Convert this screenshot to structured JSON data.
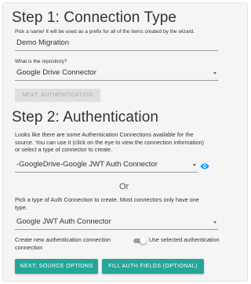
{
  "step1": {
    "title": "Step 1: Connection Type",
    "name_hint": "Pick a name! It will be used as a prefix for all of the items created by the wizard.",
    "name_value": "Demo Migration",
    "repo_label": "What is the repository?",
    "repo_value": "Google Drive Connector",
    "next_button": "NEXT: AUTHENTICATION"
  },
  "step2": {
    "title": "Step 2: Authentication",
    "intro_line1": "Looks like there are some Authentication Connections available for the",
    "intro_line2": "source. You can use it (click on the eye to view the connection information)",
    "intro_line3": "or select a type of connector to create.",
    "existing_connection_value": "-GoogleDrive-Google JWT Auth Connector",
    "or_label": "Or",
    "pick_line1": "Pick a type of Auth Connection to create. Most connectors only have one",
    "pick_line2": "type.",
    "auth_type_value": "Google JWT Auth Connector",
    "toggle_left_line1": "Create new authentication connection",
    "toggle_left_line2": "connection",
    "toggle_right": "Use selected authentication",
    "source_button": "NEXT: SOURCE OPTIONS",
    "fill_button": "FILL AUTH FIELDS (OPTIONAL)"
  },
  "icons": {
    "view": "eye-icon",
    "dropdown": "caret-down-icon"
  },
  "colors": {
    "accent": "#26a69a",
    "eye_icon": "#2196f3",
    "disabled_button": "#dfdfdf"
  }
}
